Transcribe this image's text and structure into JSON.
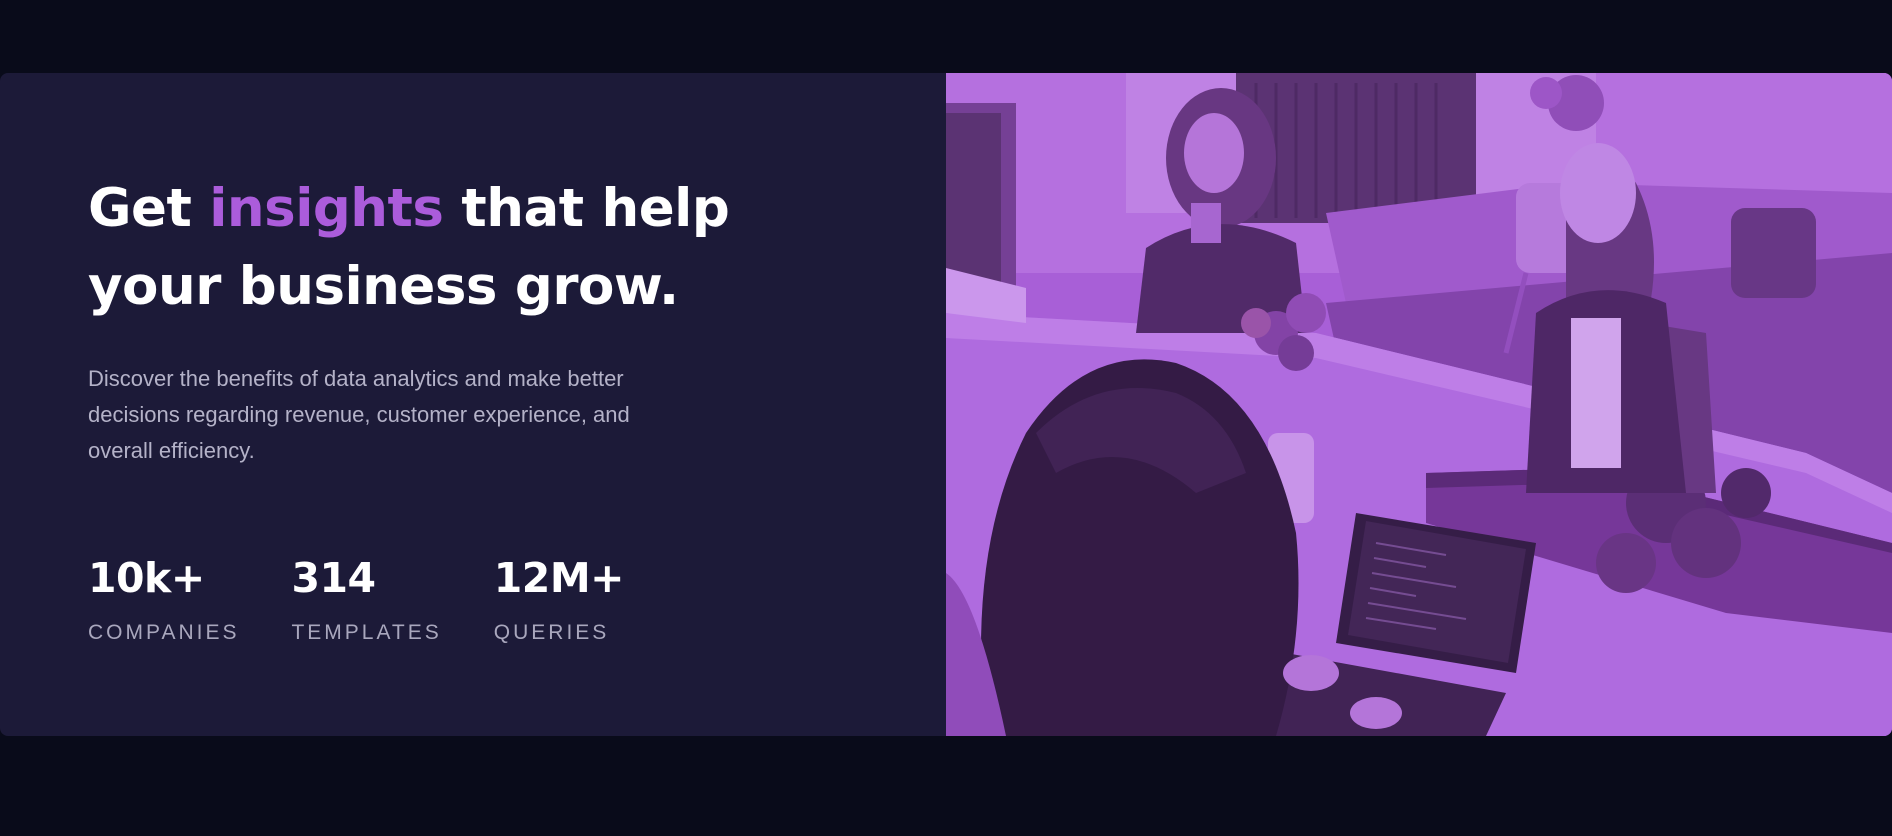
{
  "hero": {
    "headline_start": "Get ",
    "headline_accent": "insights",
    "headline_end": " that help your business grow.",
    "description": "Discover the benefits of data analytics and make better decisions regarding revenue, customer experience, and overall efficiency.",
    "stats": [
      {
        "value": "10k+",
        "label": "Companies"
      },
      {
        "value": "314",
        "label": "Templates"
      },
      {
        "value": "12M+",
        "label": "Queries"
      }
    ]
  },
  "colors": {
    "page_background": "#090b1a",
    "card_background": "#1c1a38",
    "accent": "#ab5cdb",
    "image_tint": "#aa5cdb"
  },
  "image": {
    "icon": "people-working-at-desk-photo"
  }
}
